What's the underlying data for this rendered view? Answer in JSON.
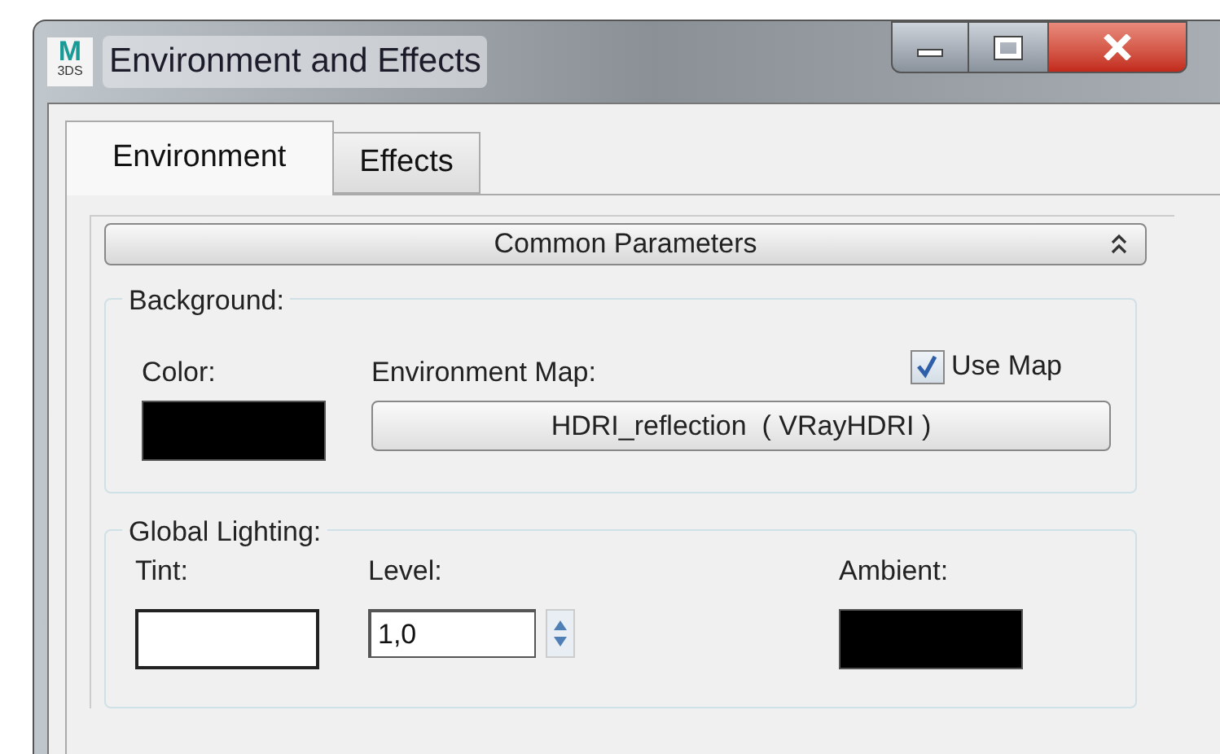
{
  "window": {
    "title": "Environment and Effects",
    "app_icon": {
      "top": "M",
      "bottom": "3DS"
    }
  },
  "tabs": [
    {
      "label": "Environment",
      "selected": true
    },
    {
      "label": "Effects",
      "selected": false
    }
  ],
  "rollout": {
    "title": "Common Parameters",
    "expanded": true
  },
  "background": {
    "title": "Background:",
    "color_label": "Color:",
    "color": "#000000",
    "map_label": "Environment Map:",
    "use_map": {
      "label": "Use Map",
      "checked": true
    },
    "map_button": "HDRI_reflection  ( VRayHDRI )"
  },
  "global_lighting": {
    "title": "Global Lighting:",
    "tint": {
      "label": "Tint:",
      "color": "#ffffff"
    },
    "level_label": "Level:",
    "level_value": "1,0",
    "ambient": {
      "label": "Ambient:",
      "color": "#000000"
    }
  }
}
